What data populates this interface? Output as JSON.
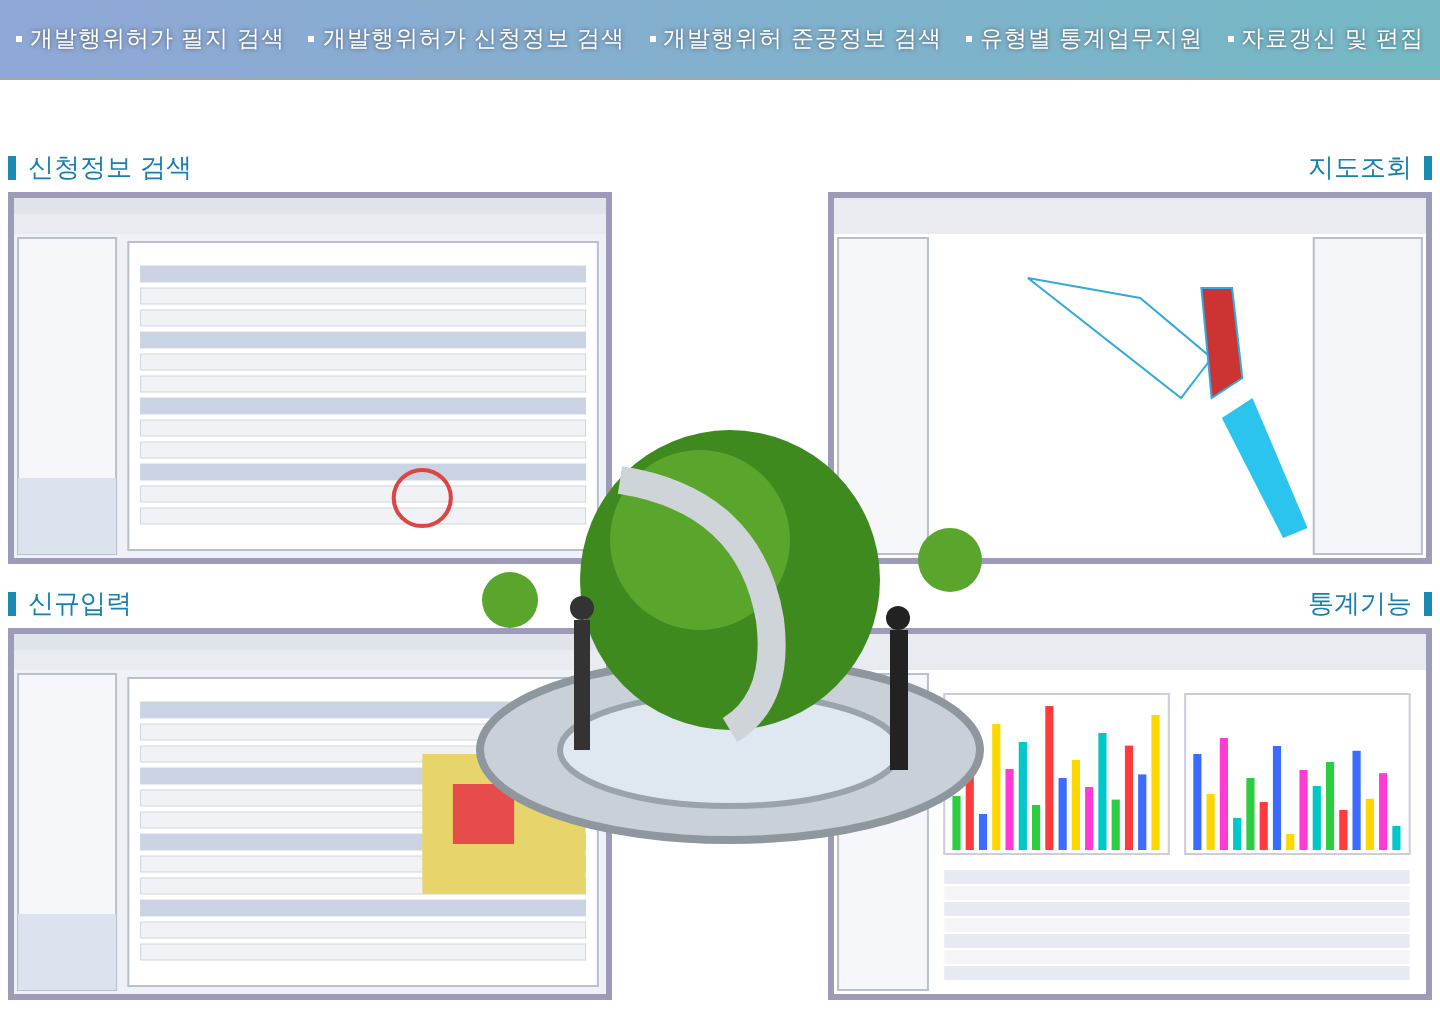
{
  "nav": [
    {
      "label": "개발행위허가 필지 검색"
    },
    {
      "label": "개발행위허가 신청정보 검색"
    },
    {
      "label": "개발행위허 준공정보 검색"
    },
    {
      "label": "유형별 통계업무지원"
    },
    {
      "label": "자료갱신 및 편집"
    }
  ],
  "sections": [
    {
      "title": "신청정보 검색",
      "kind": "form"
    },
    {
      "title": "지도조회",
      "kind": "map"
    },
    {
      "title": "신규입력",
      "kind": "form"
    },
    {
      "title": "통계기능",
      "kind": "chart"
    }
  ]
}
